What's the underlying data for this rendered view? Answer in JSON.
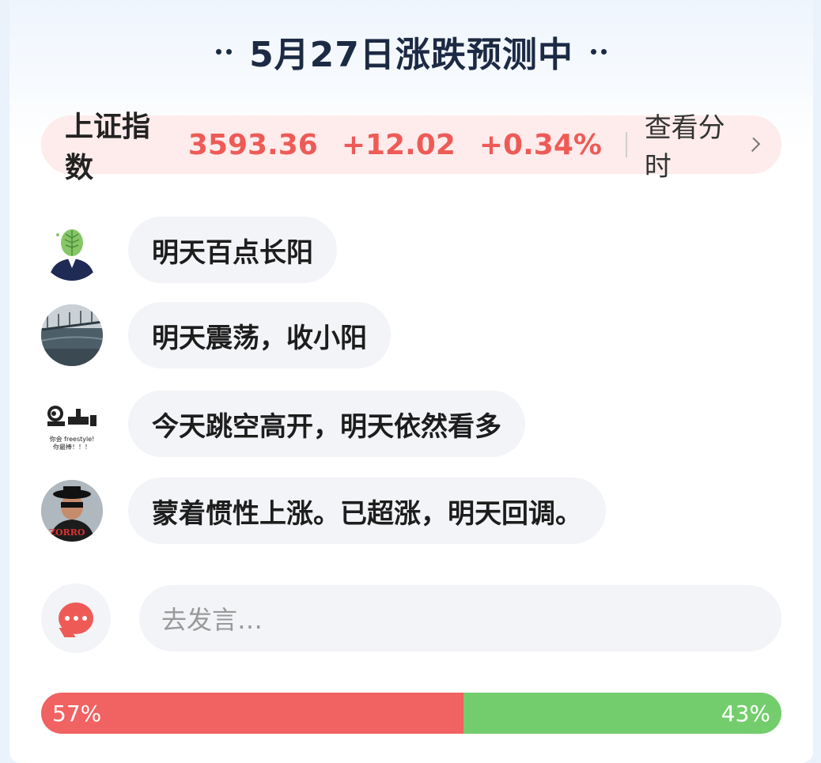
{
  "header": {
    "title": "5月27日涨跌预测中"
  },
  "index": {
    "name": "上证指数",
    "value": "3593.36",
    "change": "+12.02",
    "change_pct": "+0.34%",
    "view_label": "查看分时"
  },
  "comments": [
    {
      "text": "明天百点长阳",
      "avatar": "leaf-head-avatar"
    },
    {
      "text": "明天震荡，收小阳",
      "avatar": "bridge-photo-avatar"
    },
    {
      "text": "今天跳空高开，明天依然看多",
      "avatar": "panda-meme-avatar",
      "avatar_caption": [
        "你会 freestyle!",
        "你最棒！！！"
      ]
    },
    {
      "text": "蒙着惯性上涨。已超涨，明天回调。",
      "avatar": "zorro-avatar",
      "avatar_caption": [
        "ZORRO"
      ]
    }
  ],
  "input": {
    "placeholder": "去发言…"
  },
  "vote": {
    "up_pct": 57,
    "down_pct": 43,
    "up_label": "57%",
    "down_label": "43%"
  },
  "colors": {
    "up": "#f16262",
    "down": "#74cd6d",
    "accent": "#ee5b57",
    "title": "#1c2a44"
  }
}
